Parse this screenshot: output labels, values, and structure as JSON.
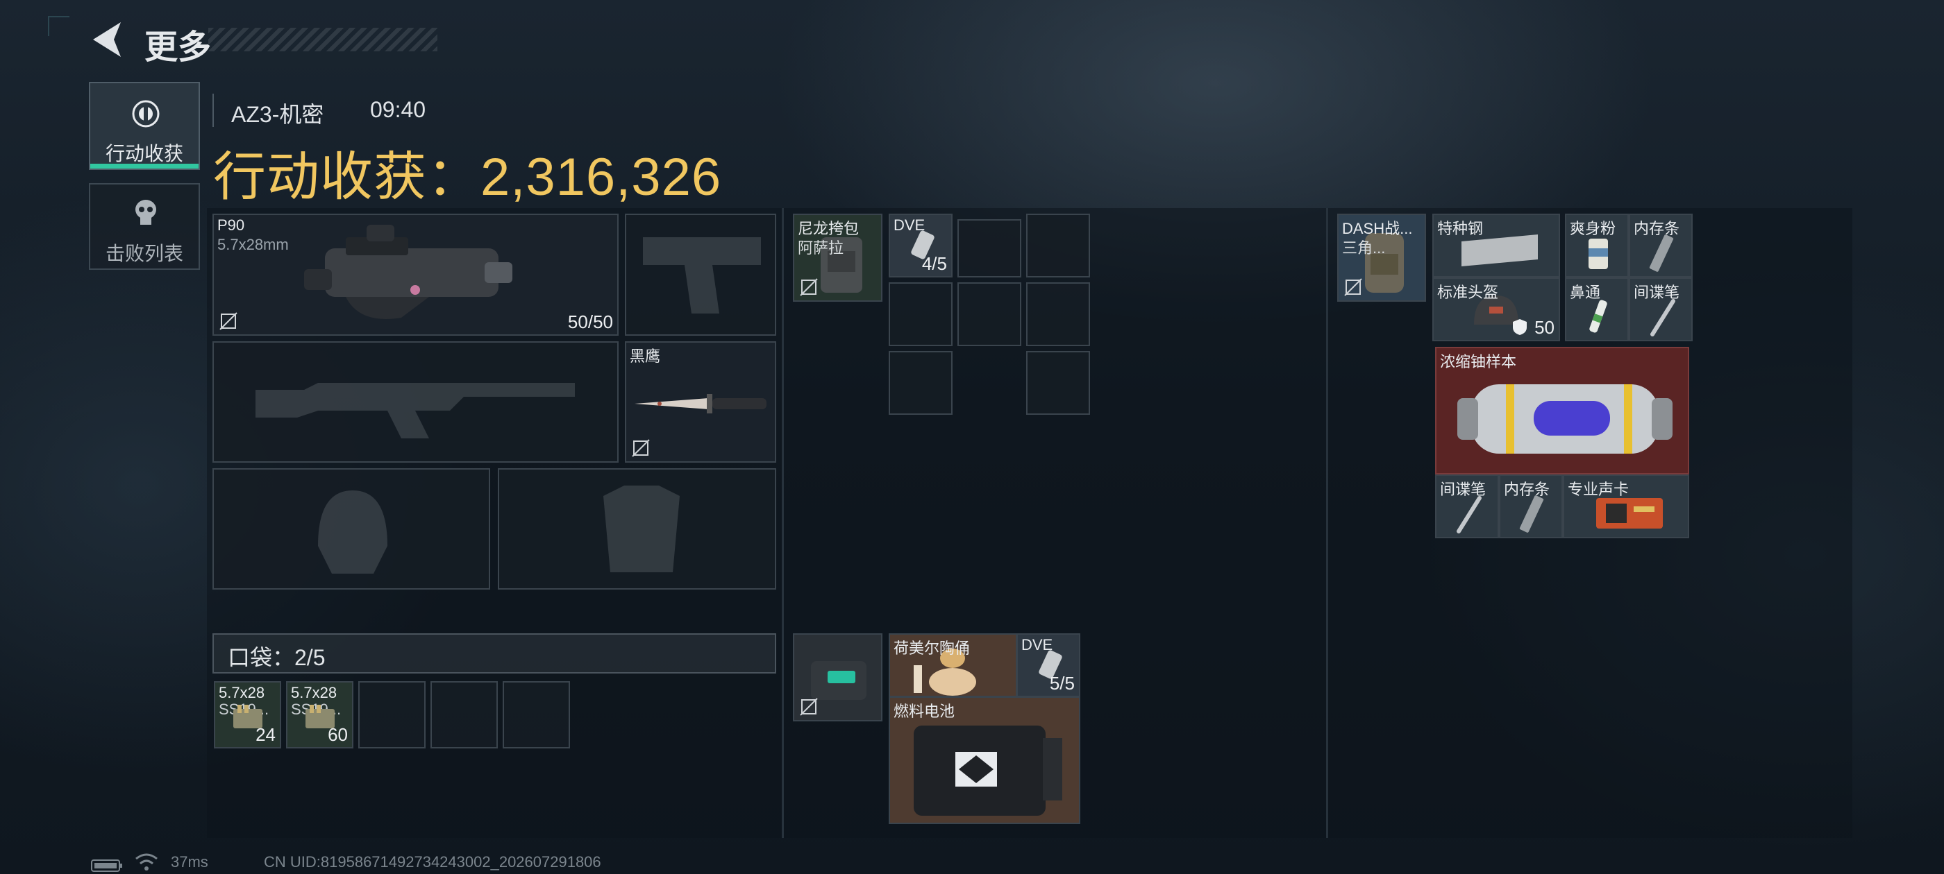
{
  "header": {
    "title": "更多"
  },
  "tabs": [
    {
      "label": "行动收获",
      "active": true,
      "icon": "operation-icon"
    },
    {
      "label": "击败列表",
      "active": false,
      "icon": "skull-icon"
    }
  ],
  "info": {
    "location": "AZ3-机密",
    "time": "09:40"
  },
  "harvest": {
    "text": "行动收获：2,316,326"
  },
  "equipment": {
    "primary": {
      "name": "P90",
      "ammo_type": "5.7x28mm",
      "ammo": "50/50"
    },
    "knife": {
      "name": "黑鹰"
    }
  },
  "pockets": {
    "label": "口袋：2/5",
    "items": [
      {
        "name": "5.7x28",
        "sub": "SS19...",
        "count": "24"
      },
      {
        "name": "5.7x28",
        "sub": "SS19...",
        "count": "60"
      }
    ]
  },
  "chest_rig": {
    "name": "尼龙挎包",
    "sub": "阿萨拉",
    "items": [
      {
        "name": "DVE",
        "count": "4/5"
      }
    ]
  },
  "bag2": {
    "items": [
      {
        "name": "荷美尔陶俑"
      },
      {
        "name": "DVE",
        "count": "5/5"
      },
      {
        "name": "燃料电池"
      }
    ]
  },
  "backpack": {
    "name": "DASH战...",
    "sub": "三角...",
    "items": [
      {
        "name": "特种钢"
      },
      {
        "name": "爽身粉"
      },
      {
        "name": "内存条"
      },
      {
        "name": "标准头盔",
        "count": "50"
      },
      {
        "name": "鼻通"
      },
      {
        "name": "间谍笔"
      },
      {
        "name": "浓缩铀样本"
      },
      {
        "name": "间谍笔"
      },
      {
        "name": "内存条"
      },
      {
        "name": "专业声卡"
      }
    ]
  },
  "status": {
    "ping": "37ms",
    "uid": "CN UID:8195867149273424300​2_202607291806"
  },
  "colors": {
    "accent": "#31c7a0",
    "harvest": "#f1c760",
    "rare": "#5a2424",
    "uncommon": "#26352f"
  }
}
